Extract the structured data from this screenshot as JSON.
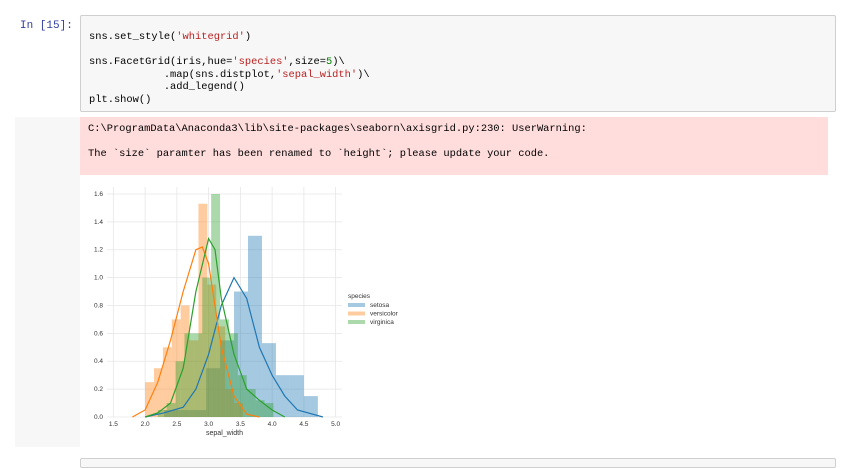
{
  "cell": {
    "prompt": "In [15]:",
    "code_lines": [
      [
        {
          "t": "sns.set_style(",
          "c": ""
        },
        {
          "t": "'whitegrid'",
          "c": "str"
        },
        {
          "t": ")",
          "c": ""
        }
      ],
      [
        {
          "t": "",
          "c": ""
        }
      ],
      [
        {
          "t": "sns.FacetGrid(iris,hue=",
          "c": ""
        },
        {
          "t": "'species'",
          "c": "str"
        },
        {
          "t": ",size=",
          "c": ""
        },
        {
          "t": "5",
          "c": "num"
        },
        {
          "t": ")\\",
          "c": ""
        }
      ],
      [
        {
          "t": "            .map(sns.distplot,",
          "c": ""
        },
        {
          "t": "'sepal_width'",
          "c": "str"
        },
        {
          "t": ")\\",
          "c": ""
        }
      ],
      [
        {
          "t": "            .add_legend()",
          "c": ""
        }
      ],
      [
        {
          "t": "plt.show()",
          "c": ""
        }
      ]
    ]
  },
  "output": {
    "warning_line1": "C:\\ProgramData\\Anaconda3\\lib\\site-packages\\seaborn\\axisgrid.py:230: UserWarning:",
    "warning_line2": "The `size` paramter has been renamed to `height`; please update your code."
  },
  "chart_data": {
    "type": "bar",
    "xlabel": "sepal_width",
    "ylabel": "",
    "xlim": [
      1.4,
      5.1
    ],
    "ylim": [
      0,
      1.65
    ],
    "xticks": [
      "1.5",
      "2.0",
      "2.5",
      "3.0",
      "3.5",
      "4.0",
      "4.5",
      "5.0"
    ],
    "yticks": [
      "0.0",
      "0.2",
      "0.4",
      "0.6",
      "0.8",
      "1.0",
      "1.2",
      "1.4",
      "1.6"
    ],
    "grid": true,
    "legend": {
      "title": "species",
      "placement": "right"
    },
    "series": [
      {
        "name": "setosa",
        "color": "#1f77b4",
        "hist_start": 2.3,
        "bin_width": 0.22,
        "hist": [
          0.05,
          0.05,
          0.05,
          0.35,
          0.55,
          0.9,
          1.3,
          0.53,
          0.3,
          0.3,
          0.15
        ],
        "kde": [
          [
            2.0,
            0.0
          ],
          [
            2.3,
            0.03
          ],
          [
            2.6,
            0.07
          ],
          [
            2.8,
            0.2
          ],
          [
            3.0,
            0.45
          ],
          [
            3.2,
            0.8
          ],
          [
            3.4,
            1.0
          ],
          [
            3.6,
            0.85
          ],
          [
            3.8,
            0.5
          ],
          [
            4.0,
            0.3
          ],
          [
            4.2,
            0.15
          ],
          [
            4.4,
            0.05
          ],
          [
            4.8,
            0.0
          ]
        ]
      },
      {
        "name": "versicolor",
        "color": "#ff7f0e",
        "hist_start": 2.0,
        "bin_width": 0.14,
        "hist": [
          0.25,
          0.35,
          0.5,
          0.7,
          0.8,
          0.55,
          1.53,
          0.95,
          0.65,
          0.2,
          0.1
        ],
        "kde": [
          [
            1.8,
            0.0
          ],
          [
            2.0,
            0.05
          ],
          [
            2.2,
            0.25
          ],
          [
            2.4,
            0.55
          ],
          [
            2.6,
            0.9
          ],
          [
            2.8,
            1.2
          ],
          [
            2.9,
            1.22
          ],
          [
            3.0,
            1.1
          ],
          [
            3.2,
            0.5
          ],
          [
            3.4,
            0.15
          ],
          [
            3.6,
            0.02
          ],
          [
            3.8,
            0.0
          ]
        ]
      },
      {
        "name": "virginica",
        "color": "#2ca02c",
        "hist_start": 2.2,
        "bin_width": 0.14,
        "hist": [
          0.05,
          0.1,
          0.4,
          0.6,
          0.6,
          1.0,
          1.6,
          0.7,
          0.6,
          0.3,
          0.2,
          0.12,
          0.1
        ],
        "kde": [
          [
            2.0,
            0.0
          ],
          [
            2.2,
            0.03
          ],
          [
            2.4,
            0.1
          ],
          [
            2.6,
            0.35
          ],
          [
            2.8,
            0.9
          ],
          [
            3.0,
            1.28
          ],
          [
            3.1,
            1.2
          ],
          [
            3.2,
            0.85
          ],
          [
            3.4,
            0.45
          ],
          [
            3.6,
            0.2
          ],
          [
            3.8,
            0.12
          ],
          [
            4.0,
            0.05
          ],
          [
            4.2,
            0.0
          ]
        ]
      }
    ]
  }
}
